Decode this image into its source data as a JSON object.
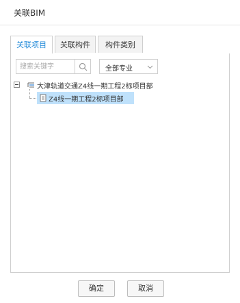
{
  "dialog": {
    "title": "关联BIM"
  },
  "tabs": [
    {
      "label": "关联项目",
      "active": true
    },
    {
      "label": "关联构件",
      "active": false
    },
    {
      "label": "构件类别",
      "active": false
    }
  ],
  "search": {
    "placeholder": "搜索关键字",
    "value": ""
  },
  "filter": {
    "selected": "全部专业"
  },
  "tree": {
    "nodes": [
      {
        "label": "大津轨道交通Z4线一期工程2标项目部",
        "expanded": true
      },
      {
        "label": "Z4线一期工程2标项目部",
        "selected": true
      }
    ]
  },
  "footer": {
    "confirm_label": "确定",
    "cancel_label": "取消"
  },
  "colors": {
    "accent": "#1e88d8",
    "selection": "#bfe1fb",
    "border": "#cfcfcf"
  }
}
